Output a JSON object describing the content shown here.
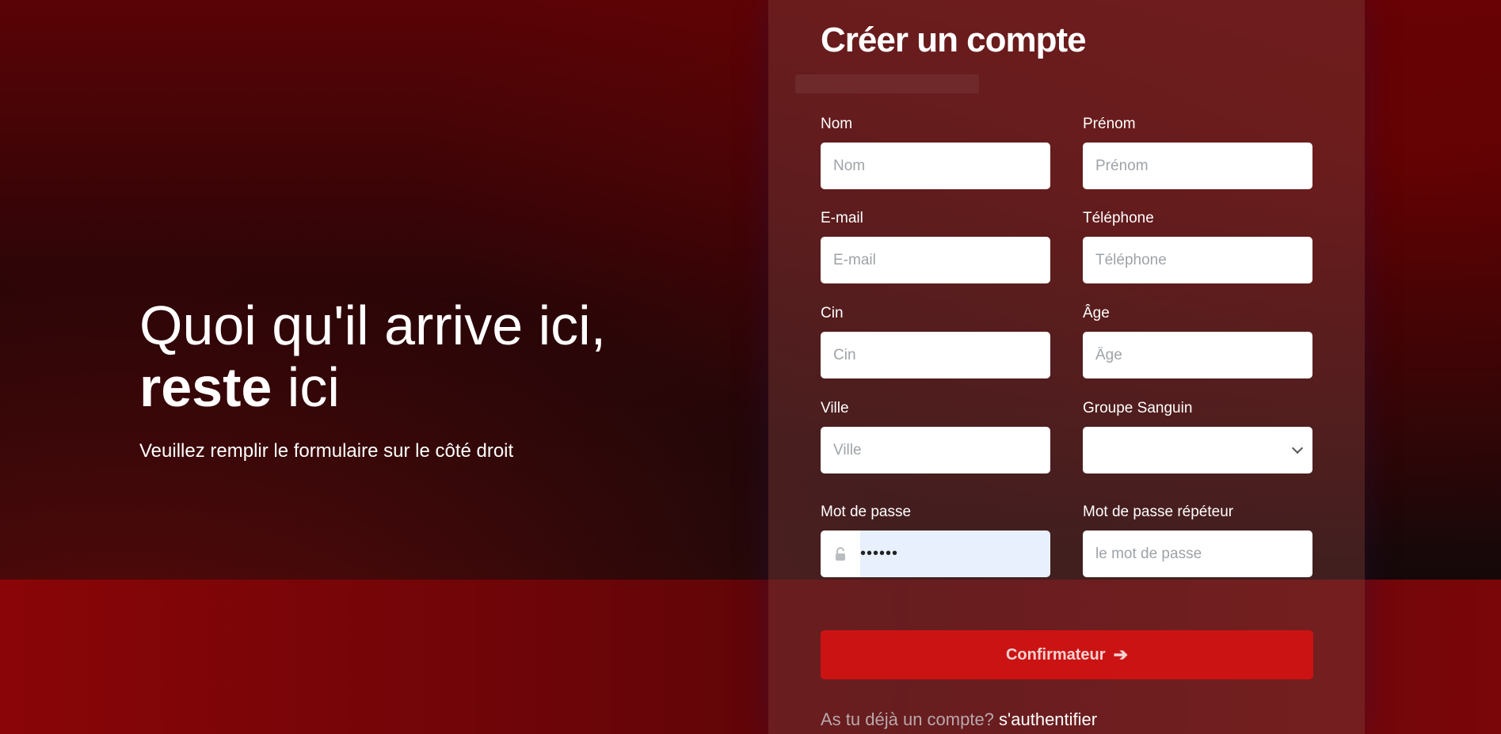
{
  "hero": {
    "line1": "Quoi qu'il arrive ici,",
    "line2_bold": "reste",
    "line2_rest": " ici",
    "subtitle": "Veuillez remplir le formulaire sur le côté droit"
  },
  "form": {
    "title": "Créer un compte",
    "fields": {
      "nom": {
        "label": "Nom",
        "placeholder": "Nom",
        "value": ""
      },
      "prenom": {
        "label": "Prénom",
        "placeholder": "Prénom",
        "value": ""
      },
      "email": {
        "label": "E-mail",
        "placeholder": "E-mail",
        "value": ""
      },
      "telephone": {
        "label": "Téléphone",
        "placeholder": "Téléphone",
        "value": ""
      },
      "cin": {
        "label": "Cin",
        "placeholder": "Cin",
        "value": ""
      },
      "age": {
        "label": "Âge",
        "placeholder": "Âge",
        "value": ""
      },
      "ville": {
        "label": "Ville",
        "placeholder": "Ville",
        "value": ""
      },
      "groupe": {
        "label": "Groupe Sanguin",
        "selected": ""
      },
      "password": {
        "label": "Mot de passe",
        "masked_value": "••••••",
        "icon": "lock-icon"
      },
      "password_repeat": {
        "label": "Mot de passe répéteur",
        "placeholder": "le mot de passe",
        "value": ""
      }
    },
    "submit_label": "Confirmateur",
    "submit_icon": "arrow-right-icon",
    "login_question": "As tu déjà un compte?",
    "login_link": "s'authentifier"
  },
  "colors": {
    "accent": "#cc1313",
    "panel": "#6e3a3b",
    "autofill": "#e8f0fe"
  }
}
